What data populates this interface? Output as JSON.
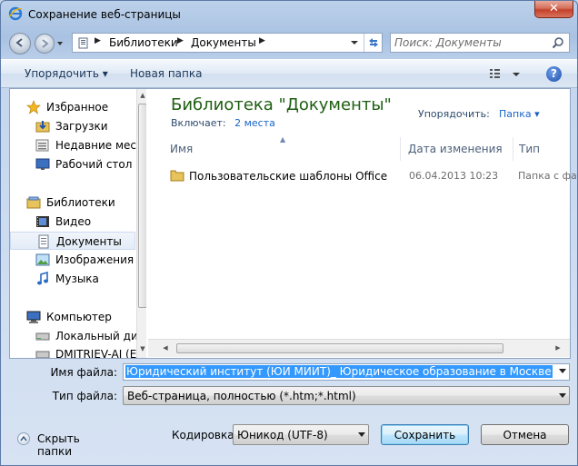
{
  "window": {
    "title": "Сохранение веб-страницы",
    "close_label": "✕"
  },
  "nav": {
    "breadcrumb": [
      "Библиотеки",
      "Документы"
    ],
    "search_placeholder": "Поиск: Документы"
  },
  "toolbar": {
    "organize_label": "Упорядочить ▾",
    "new_folder_label": "Новая папка",
    "help_label": "?"
  },
  "sidebar": {
    "items": [
      {
        "label": "Избранное",
        "icon": "star-icon"
      },
      {
        "label": "Загрузки",
        "icon": "downloads-icon"
      },
      {
        "label": "Недавние места",
        "icon": "recent-places-icon"
      },
      {
        "label": "Рабочий стол",
        "icon": "desktop-icon"
      },
      {
        "label": "Библиотеки",
        "icon": "libraries-icon"
      },
      {
        "label": "Видео",
        "icon": "video-icon"
      },
      {
        "label": "Документы",
        "icon": "documents-icon"
      },
      {
        "label": "Изображения",
        "icon": "pictures-icon"
      },
      {
        "label": "Музыка",
        "icon": "music-icon"
      },
      {
        "label": "Компьютер",
        "icon": "computer-icon"
      },
      {
        "label": "Локальный диск",
        "icon": "disk-icon"
      },
      {
        "label": "DMITRIEV-AI (E:)",
        "icon": "drive-icon"
      }
    ]
  },
  "library": {
    "title": "Библиотека \"Документы\"",
    "includes_label": "Включает:",
    "includes_link": "2 места",
    "arrange_label": "Упорядочить:",
    "arrange_value": "Папка"
  },
  "columns": {
    "name": "Имя",
    "date": "Дата изменения",
    "type": "Тип"
  },
  "files": [
    {
      "name": "Пользовательские шаблоны Office",
      "date": "06.04.2013 10:23",
      "type": "Папка с фай"
    }
  ],
  "form": {
    "filename_label": "Имя файла:",
    "filename_value": "Юридический институт (ЮИ МИИТ)_ Юридическое образование в Москве",
    "filetype_label": "Тип файла:",
    "filetype_value": "Веб-страница, полностью (*.htm;*.html)",
    "encoding_label": "Кодировка:",
    "encoding_value": "Юникод (UTF-8)",
    "hide_folders_label": "Скрыть папки",
    "save_label": "Сохранить",
    "cancel_label": "Отмена"
  }
}
